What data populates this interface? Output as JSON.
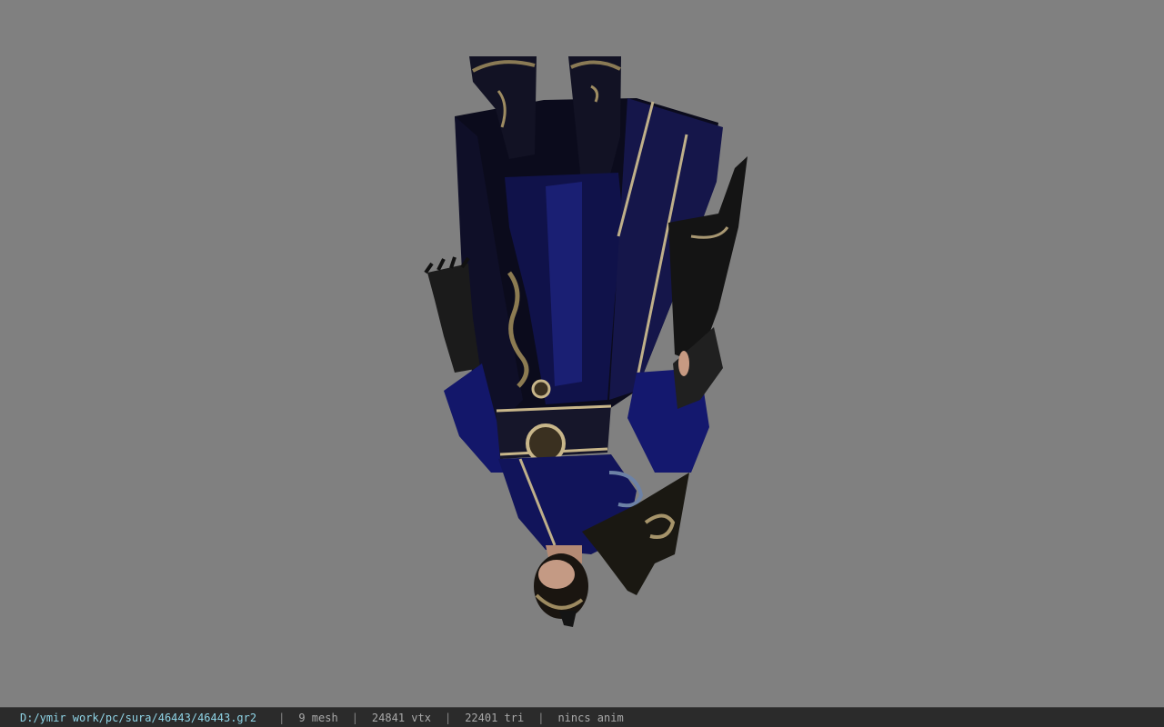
{
  "viewport": {
    "background": "#808080",
    "model": "upside-down armored character model"
  },
  "status_bar": {
    "file_path": "D:/ymir work/pc/sura/46443/46443.gr2",
    "separator": "|",
    "mesh_count": "9 mesh",
    "vertex_count": "24841 vtx",
    "triangle_count": "22401 tri",
    "animation": "nincs anim"
  },
  "colors": {
    "path_text": "#8fd4e6",
    "stat_text": "#a9a9a9",
    "status_bg": "#2b2b2b",
    "armor_dark": "#0b0b1e",
    "armor_blue": "#14186e",
    "gold_trim": "#b9a57a"
  }
}
